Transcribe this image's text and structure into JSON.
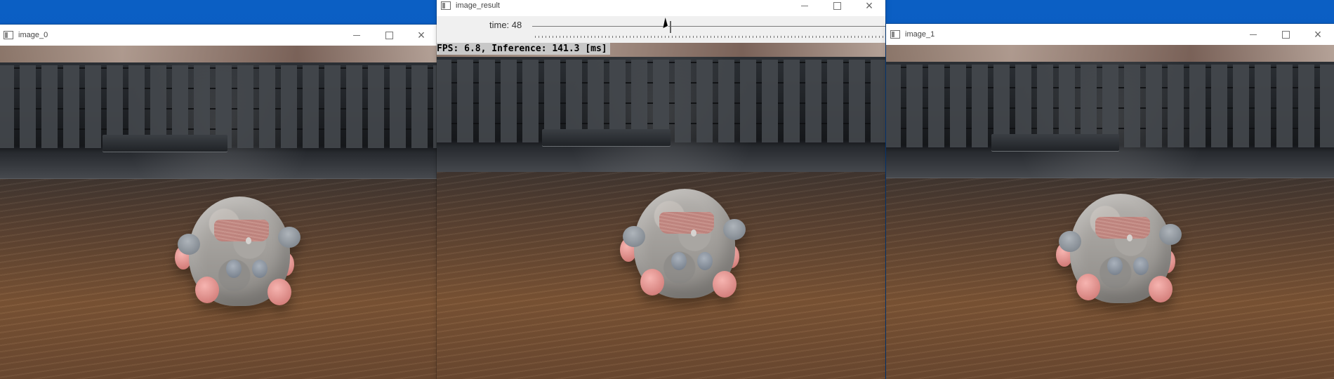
{
  "desktop": {
    "background_color": "#0b5fc4"
  },
  "windows": {
    "left": {
      "title": "image_0",
      "icon": "opencv-window-icon",
      "controls": [
        "minimize-icon",
        "maximize-icon",
        "close-icon"
      ],
      "close_label": "×"
    },
    "center": {
      "title": "image_result",
      "icon": "opencv-window-icon",
      "controls": [
        "minimize-icon",
        "maximize-icon",
        "close-icon"
      ],
      "close_label": "×",
      "trackbar": {
        "label": "time: 48",
        "value": 48,
        "fraction": 0.385
      },
      "overlay_text": "FPS: 6.8, Inference: 141.3 [ms]"
    },
    "right": {
      "title": "image_1",
      "icon": "opencv-window-icon",
      "controls": [
        "minimize-icon",
        "maximize-icon",
        "close-icon"
      ],
      "close_label": "×"
    }
  },
  "colors": {
    "desktop_blue": "#0b5fc4",
    "titlebar_white": "#ffffff",
    "overlay_gray": "#c8c8c8",
    "toy_gray": "#aaa7a3",
    "toy_pink": "#e39a95"
  }
}
